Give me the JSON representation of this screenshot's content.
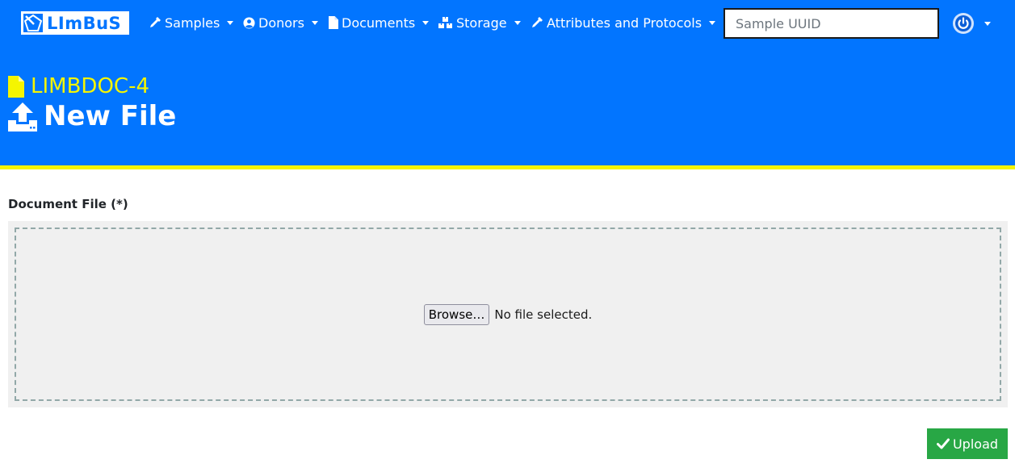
{
  "brand": {
    "name": "LImBuS",
    "icon": "limbus-logo-icon"
  },
  "nav": {
    "items": [
      {
        "label": "Samples",
        "icon": "pipette-icon"
      },
      {
        "label": "Donors",
        "icon": "user-circle-icon"
      },
      {
        "label": "Documents",
        "icon": "file-icon"
      },
      {
        "label": "Storage",
        "icon": "boxes-icon"
      },
      {
        "label": "Attributes and Protocols",
        "icon": "pipette-icon"
      }
    ],
    "search": {
      "placeholder": "Sample UUID",
      "value": ""
    },
    "user_menu": {
      "icon": "power-icon"
    }
  },
  "header": {
    "document_id": "LIMBDOC-4",
    "document_icon": "file-icon",
    "title": "New File",
    "title_icon": "upload-icon"
  },
  "form": {
    "file_label": "Document File (*)",
    "browse_label": "Browse…",
    "file_status": "No file selected.",
    "submit_label": "Upload",
    "submit_icon": "check-icon"
  },
  "colors": {
    "header_bg": "#0275ff",
    "accent_yellow": "#f5f500",
    "dropzone_bg": "#f0f0f0",
    "upload_green": "#28a745"
  }
}
